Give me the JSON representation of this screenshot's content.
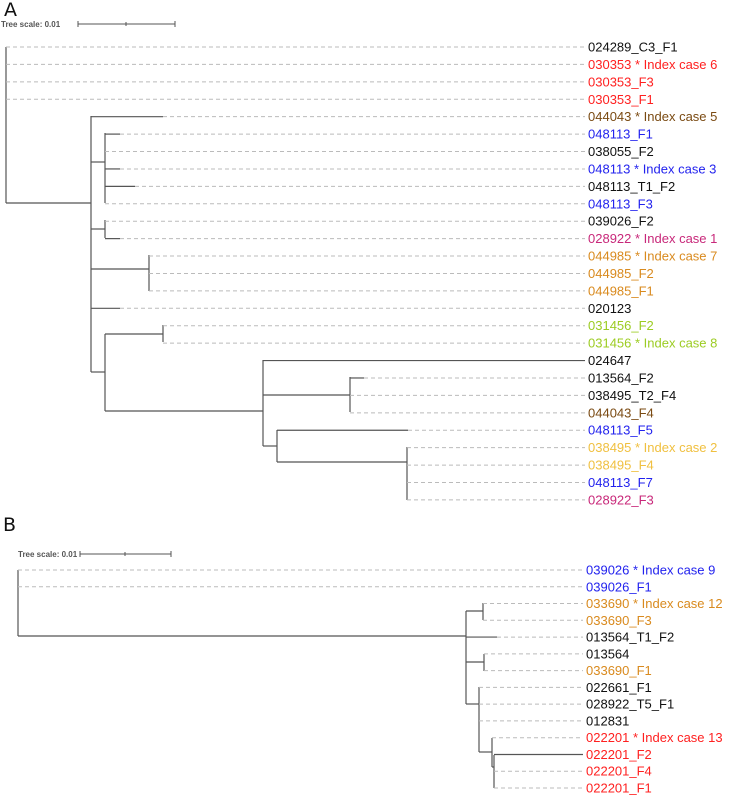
{
  "colors": {
    "black": "#111111",
    "red": "#ff2020",
    "blue": "#2222ee",
    "brown": "#7a4a12",
    "magenta": "#c8287a",
    "orange": "#d98a1e",
    "yellow": "#f0c040",
    "green": "#9ccc22",
    "branch": "#555555",
    "dashed": "#bbbbbb"
  },
  "panels": [
    {
      "letter": "A",
      "scale_text": "Tree scale: 0.01",
      "leaves": [
        {
          "name": "024289_C3_F1",
          "color": "black"
        },
        {
          "name": "030353 * Index case 6",
          "color": "red"
        },
        {
          "name": "030353_F3",
          "color": "red"
        },
        {
          "name": "030353_F1",
          "color": "red"
        },
        {
          "name": "044043 * Index case 5",
          "color": "brown"
        },
        {
          "name": "048113_F1",
          "color": "blue"
        },
        {
          "name": "038055_F2",
          "color": "black"
        },
        {
          "name": "048113 * Index case 3",
          "color": "blue"
        },
        {
          "name": "048113_T1_F2",
          "color": "black"
        },
        {
          "name": "048113_F3",
          "color": "blue"
        },
        {
          "name": "039026_F2",
          "color": "black"
        },
        {
          "name": "028922 * Index case 1",
          "color": "magenta"
        },
        {
          "name": "044985 * Index case 7",
          "color": "orange"
        },
        {
          "name": "044985_F2",
          "color": "orange"
        },
        {
          "name": "044985_F1",
          "color": "orange"
        },
        {
          "name": "020123",
          "color": "black"
        },
        {
          "name": "031456_F2",
          "color": "green"
        },
        {
          "name": "031456 * Index case 8",
          "color": "green"
        },
        {
          "name": "024647",
          "color": "black"
        },
        {
          "name": "013564_F2",
          "color": "black"
        },
        {
          "name": "038495_T2_F4",
          "color": "black"
        },
        {
          "name": "044043_F4",
          "color": "brown"
        },
        {
          "name": "048113_F5",
          "color": "blue"
        },
        {
          "name": "038495 * Index case 2",
          "color": "yellow"
        },
        {
          "name": "038495_F4",
          "color": "yellow"
        },
        {
          "name": "048113_F7",
          "color": "blue"
        },
        {
          "name": "028922_F3",
          "color": "magenta"
        }
      ]
    },
    {
      "letter": "B",
      "scale_text": "Tree scale: 0.01",
      "leaves": [
        {
          "name": "039026 * Index case 9",
          "color": "blue"
        },
        {
          "name": "039026_F1",
          "color": "blue"
        },
        {
          "name": "033690 * Index case 12",
          "color": "orange"
        },
        {
          "name": "033690_F3",
          "color": "orange"
        },
        {
          "name": "013564_T1_F2",
          "color": "black"
        },
        {
          "name": "013564",
          "color": "black"
        },
        {
          "name": "033690_F1",
          "color": "orange"
        },
        {
          "name": "022661_F1",
          "color": "black"
        },
        {
          "name": "028922_T5_F1",
          "color": "black"
        },
        {
          "name": "012831",
          "color": "black"
        },
        {
          "name": "022201 * Index case 13",
          "color": "red"
        },
        {
          "name": "022201_F2",
          "color": "red"
        },
        {
          "name": "022201_F4",
          "color": "red"
        },
        {
          "name": "022201_F1",
          "color": "red"
        }
      ]
    }
  ]
}
